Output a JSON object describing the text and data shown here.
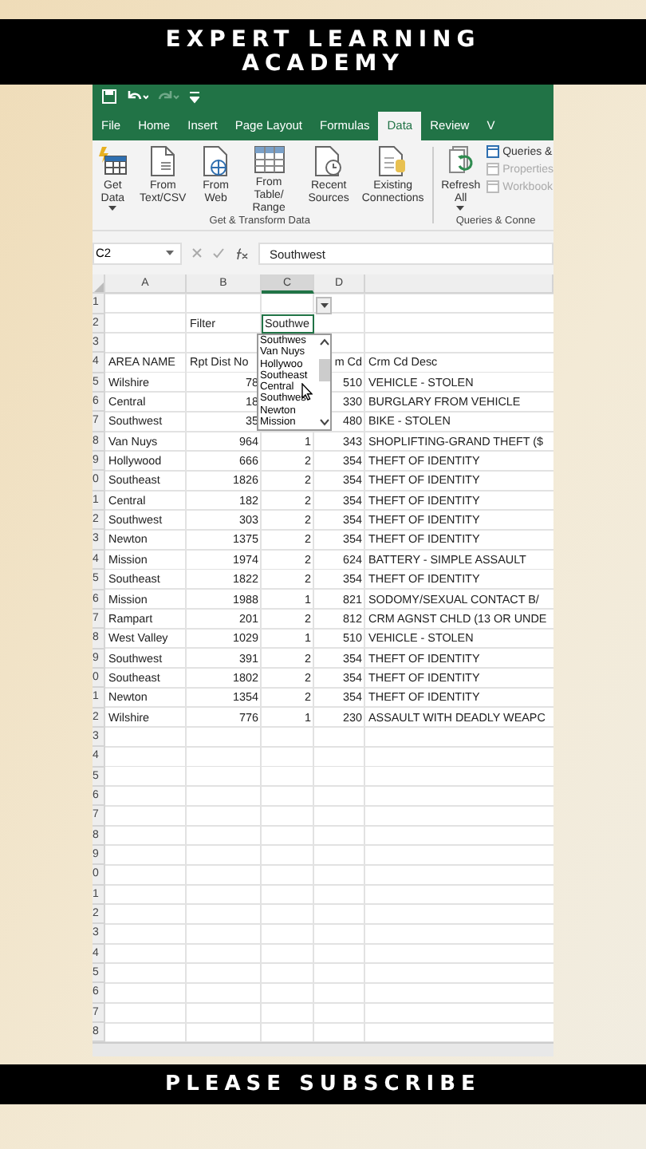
{
  "top_banner": {
    "title": "EXPERT LEARNING ACADEMY"
  },
  "ribbon": {
    "tabs": [
      {
        "label": "File",
        "selected": false
      },
      {
        "label": "Home",
        "selected": false
      },
      {
        "label": "Insert",
        "selected": false
      },
      {
        "label": "Page Layout",
        "selected": false
      },
      {
        "label": "Formulas",
        "selected": false
      },
      {
        "label": "Data",
        "selected": true
      },
      {
        "label": "Review",
        "selected": false
      },
      {
        "label": "V",
        "selected": false
      }
    ],
    "groups": [
      {
        "label": "Get & Transform Data",
        "buttons": [
          {
            "label": "Get Data",
            "kind": "database",
            "menu": true
          },
          {
            "label": "From Text/CSV",
            "kind": "document",
            "menu": false
          },
          {
            "label": "From Web",
            "kind": "web",
            "menu": false
          },
          {
            "label": "From Table/ Range",
            "kind": "table",
            "menu": false
          },
          {
            "label": "Recent Sources",
            "kind": "clock",
            "menu": false
          },
          {
            "label": "Existing Connections",
            "kind": "connections",
            "menu": false
          }
        ]
      },
      {
        "label": "Queries & Conne",
        "buttons": [
          {
            "label": "Refresh All",
            "kind": "refresh",
            "menu": true
          }
        ],
        "small_buttons": [
          {
            "label": "Queries &",
            "disabled": false
          },
          {
            "label": "Properties",
            "disabled": true
          },
          {
            "label": "Workbook",
            "disabled": true
          }
        ]
      }
    ]
  },
  "formula_bar": {
    "name_box": "C2",
    "value": "Southwest"
  },
  "sheet": {
    "columns": [
      "A",
      "B",
      "C",
      "D"
    ],
    "rows": [
      {
        "num": "1"
      },
      {
        "num": "2",
        "kind": "text",
        "cells": [
          null,
          "Filter",
          {
            "text": "Southwe",
            "selected": true
          },
          null,
          null
        ]
      },
      {
        "num": "3"
      },
      {
        "num": "4",
        "kind": "text",
        "cells": [
          "AREA NAME",
          "Rpt Dist No",
          null,
          "m Cd",
          "Crm Cd Desc"
        ]
      },
      {
        "num": "5",
        "kind": "data",
        "cells": [
          "Wilshire",
          "78",
          null,
          "510",
          "VEHICLE - STOLEN"
        ]
      },
      {
        "num": "6",
        "kind": "data",
        "cells": [
          "Central",
          "18",
          null,
          "330",
          "BURGLARY FROM VEHICLE"
        ]
      },
      {
        "num": "7",
        "kind": "data",
        "cells": [
          "Southwest",
          "35",
          null,
          "480",
          "BIKE - STOLEN"
        ]
      },
      {
        "num": "8",
        "kind": "data",
        "cells": [
          "Van Nuys",
          "964",
          "1",
          "343",
          "SHOPLIFTING-GRAND THEFT ($"
        ]
      },
      {
        "num": "9",
        "kind": "data",
        "cells": [
          "Hollywood",
          "666",
          "2",
          "354",
          "THEFT OF IDENTITY"
        ]
      },
      {
        "num": "0",
        "kind": "data",
        "cells": [
          "Southeast",
          "1826",
          "2",
          "354",
          "THEFT OF IDENTITY"
        ]
      },
      {
        "num": "1",
        "kind": "data",
        "cells": [
          "Central",
          "182",
          "2",
          "354",
          "THEFT OF IDENTITY"
        ]
      },
      {
        "num": "2",
        "kind": "data",
        "cells": [
          "Southwest",
          "303",
          "2",
          "354",
          "THEFT OF IDENTITY"
        ]
      },
      {
        "num": "3",
        "kind": "data",
        "cells": [
          "Newton",
          "1375",
          "2",
          "354",
          "THEFT OF IDENTITY"
        ]
      },
      {
        "num": "4",
        "kind": "data",
        "cells": [
          "Mission",
          "1974",
          "2",
          "624",
          "BATTERY - SIMPLE ASSAULT"
        ]
      },
      {
        "num": "5",
        "kind": "data",
        "cells": [
          "Southeast",
          "1822",
          "2",
          "354",
          "THEFT OF IDENTITY"
        ]
      },
      {
        "num": "6",
        "kind": "data",
        "cells": [
          "Mission",
          "1988",
          "1",
          "821",
          "SODOMY/SEXUAL CONTACT B/"
        ]
      },
      {
        "num": "7",
        "kind": "data",
        "cells": [
          "Rampart",
          "201",
          "2",
          "812",
          "CRM AGNST CHLD (13 OR UNDE"
        ]
      },
      {
        "num": "8",
        "kind": "data",
        "cells": [
          "West Valley",
          "1029",
          "1",
          "510",
          "VEHICLE - STOLEN"
        ]
      },
      {
        "num": "9",
        "kind": "data",
        "cells": [
          "Southwest",
          "391",
          "2",
          "354",
          "THEFT OF IDENTITY"
        ]
      },
      {
        "num": "0",
        "kind": "data",
        "cells": [
          "Southeast",
          "1802",
          "2",
          "354",
          "THEFT OF IDENTITY"
        ]
      },
      {
        "num": "1",
        "kind": "data",
        "cells": [
          "Newton",
          "1354",
          "2",
          "354",
          "THEFT OF IDENTITY"
        ]
      },
      {
        "num": "2",
        "kind": "data",
        "cells": [
          "Wilshire",
          "776",
          "1",
          "230",
          "ASSAULT WITH DEADLY WEAPC"
        ]
      },
      {
        "num": "3"
      },
      {
        "num": "4"
      },
      {
        "num": "5"
      },
      {
        "num": "6"
      },
      {
        "num": "7"
      },
      {
        "num": "8"
      },
      {
        "num": "9"
      },
      {
        "num": "0"
      },
      {
        "num": "1"
      },
      {
        "num": "2"
      },
      {
        "num": "3"
      },
      {
        "num": "4"
      },
      {
        "num": "5"
      },
      {
        "num": "6"
      },
      {
        "num": "7"
      },
      {
        "num": "8"
      }
    ],
    "dropdown_list": [
      "Southwes",
      "Van Nuys",
      "Hollywoo",
      "Southeast",
      "Central",
      "Southwes",
      "Newton",
      "Mission"
    ]
  },
  "bottom_banner": {
    "title": "PLEASE SUBSCRIBE"
  }
}
